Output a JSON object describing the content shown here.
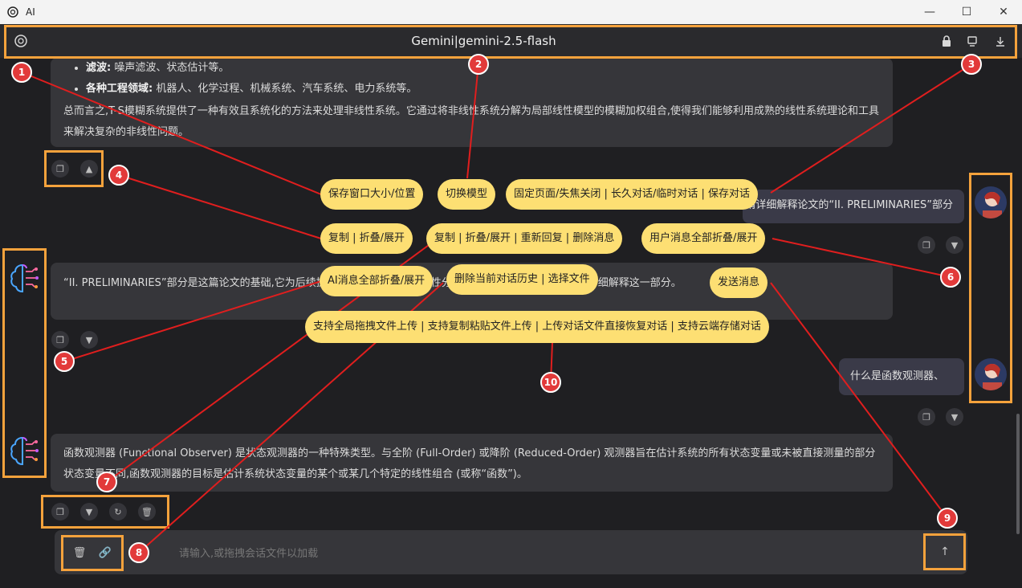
{
  "window": {
    "title": "AI"
  },
  "header": {
    "title": "Gemini|gemini-2.5-flash"
  },
  "messages": {
    "ai1": {
      "bullets": [
        {
          "bold": "滤波:",
          "text": " 噪声滤波、状态估计等。"
        },
        {
          "bold": "各种工程领域:",
          "text": " 机器人、化学过程、机械系统、汽车系统、电力系统等。"
        }
      ],
      "summary": "总而言之,T-S模糊系统提供了一种有效且系统化的方法来处理非线性系统。它通过将非线性系统分解为局部线性模型的模糊加权组合,使得我们能够利用成熟的线性系统理论和工具来解决复杂的非线性问题。"
    },
    "user1": "请详细解释论文的“II. PRELIMINARIES”部分",
    "ai2": "“II. PRELIMINARIES”部分是这篇论文的基础,它为后续提出的观测器设计和稳定性分析奠定了理论基础。下面我将详细解释这一部分。",
    "user2": "什么是函数观测器、",
    "ai3": "函数观测器 (Functional Observer) 是状态观测器的一种特殊类型。与全阶 (Full-Order) 或降阶 (Reduced-Order) 观测器旨在估计系统的所有状态变量或未被直接测量的部分状态变量不同,函数观测器的目标是估计系统状态变量的某个或某几个特定的线性组合 (或称“函数”)。"
  },
  "input": {
    "placeholder": "请输入,或拖拽会话文件以加载"
  },
  "callouts": {
    "p1": "保存窗口大小/位置",
    "p2": "切换模型",
    "p3": "固定页面/失焦关闭 | 长久对话/临时对话 | 保存对话",
    "p4": "复制 | 折叠/展开",
    "p5": "复制 | 折叠/展开 | 重新回复 | 删除消息",
    "p6": "用户消息全部折叠/展开",
    "p7": "AI消息全部折叠/展开",
    "p8": "删除当前对话历史 | 选择文件",
    "p9": "发送消息",
    "p10": "支持全局拖拽文件上传 | 支持复制粘贴文件上传 | 上传对话文件直接恢复对话 | 支持云端存储对话"
  },
  "badges": [
    "1",
    "2",
    "3",
    "4",
    "5",
    "6",
    "7",
    "8",
    "9",
    "10"
  ],
  "colors": {
    "accent": "#f5a23c",
    "callout": "#fddf73",
    "badge": "#e23a3a",
    "line": "#e01e1e"
  }
}
